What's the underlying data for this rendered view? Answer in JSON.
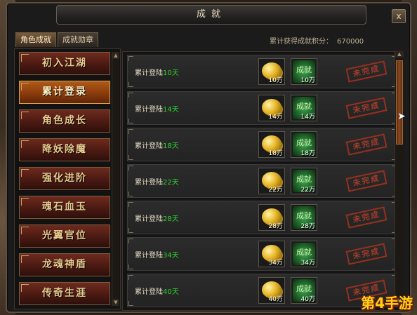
{
  "window": {
    "title": "成就",
    "close_label": "x"
  },
  "tabs": [
    {
      "label": "角色成就",
      "active": true
    },
    {
      "label": "成就勋章",
      "active": false
    }
  ],
  "score": {
    "label": "累计获得成就积分：",
    "value": "670000"
  },
  "categories": [
    {
      "label": "初入江湖",
      "active": false
    },
    {
      "label": "累计登录",
      "active": true
    },
    {
      "label": "角色成长",
      "active": false
    },
    {
      "label": "降妖除魔",
      "active": false
    },
    {
      "label": "强化进阶",
      "active": false
    },
    {
      "label": "魂石血玉",
      "active": false
    },
    {
      "label": "光翼官位",
      "active": false
    },
    {
      "label": "龙魂神盾",
      "active": false
    },
    {
      "label": "传奇生涯",
      "active": false
    }
  ],
  "achievements": [
    {
      "prefix": "累计登陆",
      "days": "10天",
      "coin_count": "10万",
      "ach_label": "成就",
      "ach_count": "10万",
      "stamp": "未完成"
    },
    {
      "prefix": "累计登陆",
      "days": "14天",
      "coin_count": "14万",
      "ach_label": "成就",
      "ach_count": "14万",
      "stamp": "未完成"
    },
    {
      "prefix": "累计登陆",
      "days": "18天",
      "coin_count": "18万",
      "ach_label": "成就",
      "ach_count": "18万",
      "stamp": "未完成"
    },
    {
      "prefix": "累计登陆",
      "days": "22天",
      "coin_count": "22万",
      "ach_label": "成就",
      "ach_count": "22万",
      "stamp": "未完成"
    },
    {
      "prefix": "累计登陆",
      "days": "28天",
      "coin_count": "28万",
      "ach_label": "成就",
      "ach_count": "28万",
      "stamp": "未完成"
    },
    {
      "prefix": "累计登陆",
      "days": "34天",
      "coin_count": "34万",
      "ach_label": "成就",
      "ach_count": "34万",
      "stamp": "未完成"
    },
    {
      "prefix": "累计登陆",
      "days": "40天",
      "coin_count": "40万",
      "ach_label": "成就",
      "ach_count": "40万",
      "stamp": "未完成"
    }
  ],
  "watermark": "第4手游",
  "colors": {
    "days_green": "#2fd12f",
    "stamp_red": "#b8402a",
    "active_tab": "#8a3c0d"
  }
}
